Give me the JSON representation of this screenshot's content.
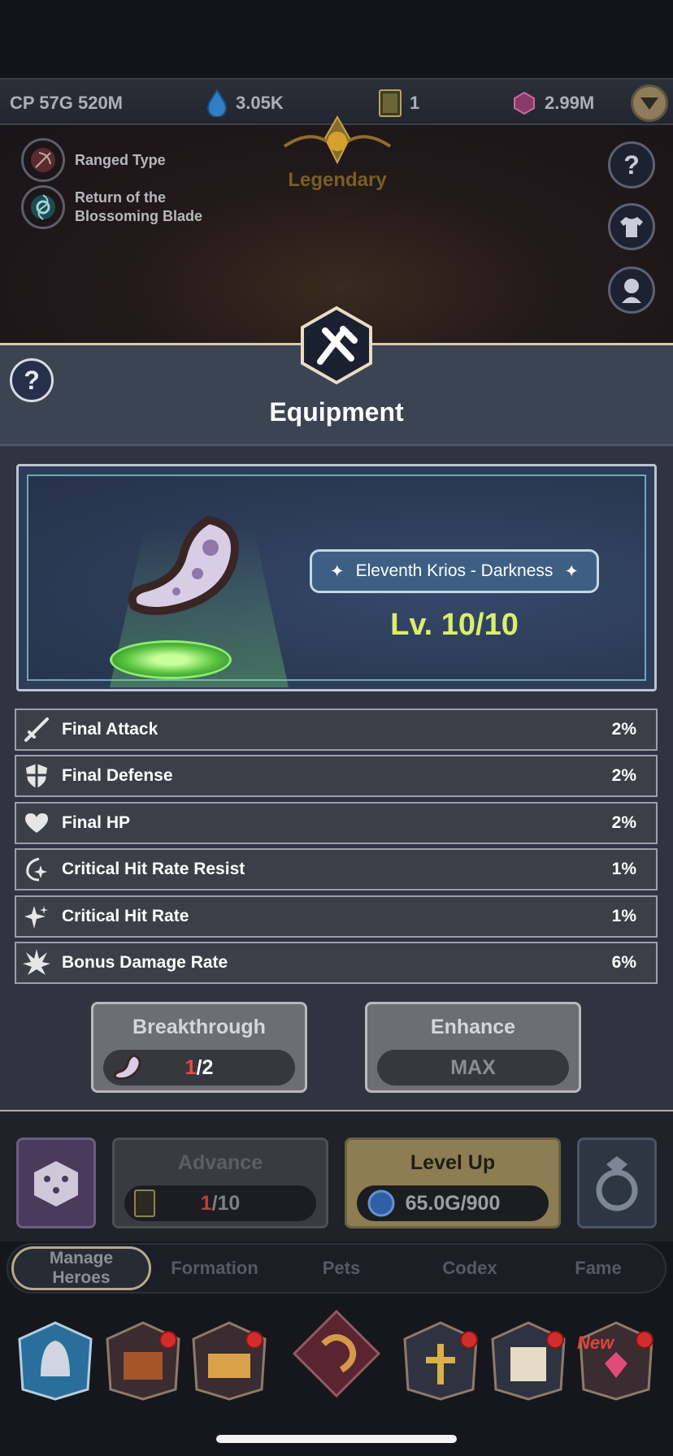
{
  "resources": {
    "cp": "CP 57G 520M",
    "gem": "3.05K",
    "cards": "1",
    "crystal": "2.99M"
  },
  "hero": {
    "traits": [
      {
        "label": "Ranged Type"
      },
      {
        "label_line1": "Return of the",
        "label_line2": "Blossoming Blade"
      }
    ],
    "rarity": "Legendary"
  },
  "modal": {
    "title": "Equipment",
    "item_name": "Eleventh Krios - Darkness",
    "level": "Lv. 10/10",
    "stats": [
      {
        "label": "Final Attack",
        "value": "2%",
        "icon": "sword-icon"
      },
      {
        "label": "Final Defense",
        "value": "2%",
        "icon": "shield-icon"
      },
      {
        "label": "Final HP",
        "value": "2%",
        "icon": "heart-icon"
      },
      {
        "label": "Critical Hit Rate Resist",
        "value": "1%",
        "icon": "crit-resist-icon"
      },
      {
        "label": "Critical Hit Rate",
        "value": "1%",
        "icon": "sparkle-icon"
      },
      {
        "label": "Bonus Damage Rate",
        "value": "6%",
        "icon": "burst-icon"
      }
    ],
    "breakthrough": {
      "label": "Breakthrough",
      "current": "1",
      "total": "/2"
    },
    "enhance": {
      "label": "Enhance",
      "value": "MAX"
    }
  },
  "actions": {
    "advance": {
      "label": "Advance",
      "current": "1",
      "total": "/10"
    },
    "level_up": {
      "label": "Level Up",
      "value": "65.0G/900"
    }
  },
  "tabs": [
    {
      "line1": "Manage",
      "line2": "Heroes"
    },
    {
      "label": "Formation"
    },
    {
      "label": "Pets"
    },
    {
      "label": "Codex"
    },
    {
      "label": "Fame"
    }
  ],
  "bottom_nav": {
    "new_label": "New"
  },
  "colors": {
    "accent_gold": "#b6aa8d",
    "level_green": "#d8ef6b",
    "alert_red": "#e2423c"
  }
}
